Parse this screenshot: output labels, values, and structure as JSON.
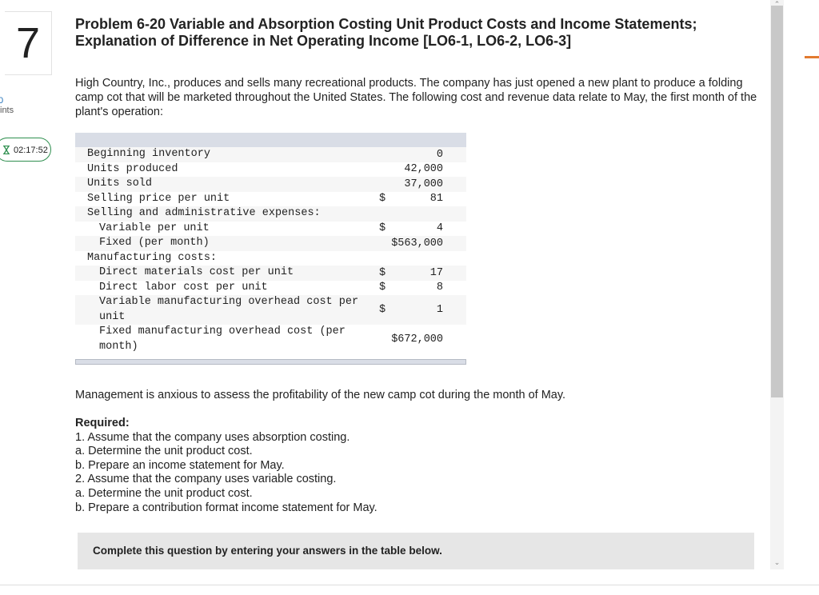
{
  "question": {
    "number": "7",
    "points_value": "0",
    "points_label": "ints",
    "timer": "02:17:52"
  },
  "problem": {
    "title_line1": "Problem 6-20 Variable and Absorption Costing Unit Product Costs and Income Statements;",
    "title_line2": "Explanation of Difference in Net Operating Income [LO6-1, LO6-2, LO6-3]",
    "intro": "High Country, Inc., produces and sells many recreational products. The company has just opened a new plant to produce a folding camp cot that will be marketed throughout the United States. The following cost and revenue data relate to May, the first month of the plant's operation:"
  },
  "data_table": {
    "rows": [
      {
        "label": "Beginning inventory",
        "dollar": "",
        "amount": "0"
      },
      {
        "label": "Units produced",
        "dollar": "",
        "amount": "42,000"
      },
      {
        "label": "Units sold",
        "dollar": "",
        "amount": "37,000"
      },
      {
        "label": "Selling price per unit",
        "dollar": "$",
        "amount": "81"
      },
      {
        "label": "Selling and administrative expenses:",
        "dollar": "",
        "amount": ""
      },
      {
        "label": "Variable per unit",
        "dollar": "$",
        "amount": "4"
      },
      {
        "label": "Fixed (per month)",
        "dollar": "",
        "amount": "$563,000"
      },
      {
        "label": "Manufacturing costs:",
        "dollar": "",
        "amount": ""
      },
      {
        "label": "Direct materials cost per unit",
        "dollar": "$",
        "amount": "17"
      },
      {
        "label": "Direct labor cost per unit",
        "dollar": "$",
        "amount": "8"
      },
      {
        "label": "Variable manufacturing overhead cost per unit",
        "dollar": "$",
        "amount": "1"
      },
      {
        "label": "Fixed manufacturing overhead cost (per month)",
        "dollar": "",
        "amount": "$672,000"
      }
    ]
  },
  "management_text": "Management is anxious to assess the profitability of the new camp cot during the month of May.",
  "required": {
    "heading": "Required:",
    "items": [
      "1. Assume that the company uses absorption costing.",
      "a. Determine the unit product cost.",
      "b. Prepare an income statement for May.",
      "2. Assume that the company uses variable costing.",
      "a. Determine the unit product cost.",
      "b. Prepare a contribution format income statement for May."
    ]
  },
  "instruction": "Complete this question by entering your answers in the table below."
}
